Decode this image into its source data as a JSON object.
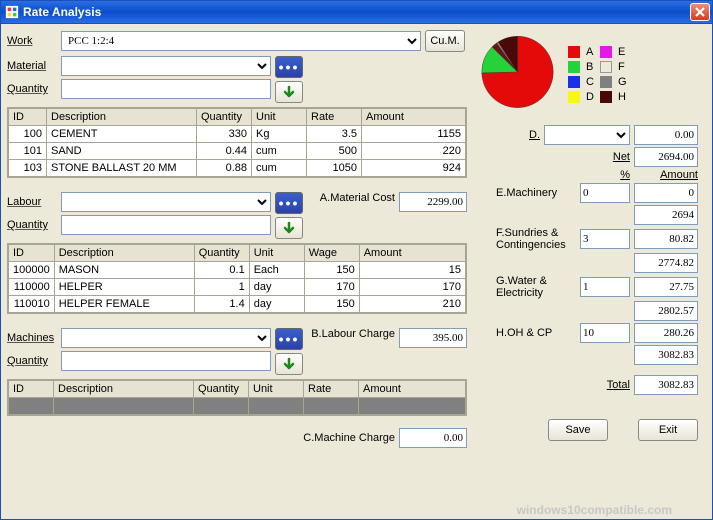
{
  "window": {
    "title": "Rate Analysis"
  },
  "work": {
    "label": "Work",
    "value": "PCC 1:2:4",
    "unit_label": "Cu.M."
  },
  "material": {
    "label": "Material",
    "qty_label": "Quantity",
    "cost_label": "A.Material Cost",
    "cost": "2299.00",
    "headers": [
      "ID",
      "Description",
      "Quantity",
      "Unit",
      "Rate",
      "Amount"
    ],
    "rows": [
      {
        "id": "100",
        "desc": "CEMENT",
        "qty": "330",
        "unit": "Kg",
        "rate": "3.5",
        "amount": "1155"
      },
      {
        "id": "101",
        "desc": "SAND",
        "qty": "0.44",
        "unit": "cum",
        "rate": "500",
        "amount": "220"
      },
      {
        "id": "103",
        "desc": "STONE BALLAST 20 MM",
        "qty": "0.88",
        "unit": "cum",
        "rate": "1050",
        "amount": "924"
      }
    ]
  },
  "labour": {
    "label": "Labour",
    "qty_label": "Quantity",
    "charge_label": "B.Labour Charge",
    "charge": "395.00",
    "headers": [
      "ID",
      "Description",
      "Quantity",
      "Unit",
      "Wage",
      "Amount"
    ],
    "rows": [
      {
        "id": "100000",
        "desc": "MASON",
        "qty": "0.1",
        "unit": "Each",
        "wage": "150",
        "amount": "15"
      },
      {
        "id": "110000",
        "desc": "HELPER",
        "qty": "1",
        "unit": "day",
        "wage": "170",
        "amount": "170"
      },
      {
        "id": "110010",
        "desc": "HELPER FEMALE",
        "qty": "1.4",
        "unit": "day",
        "wage": "150",
        "amount": "210"
      }
    ]
  },
  "machines": {
    "label": "Machines",
    "qty_label": "Quantity",
    "charge_label": "C.Machine Charge",
    "charge": "0.00",
    "headers": [
      "ID",
      "Description",
      "Quantity",
      "Unit",
      "Rate",
      "Amount"
    ]
  },
  "legend": {
    "A": "A",
    "B": "B",
    "C": "C",
    "D": "D",
    "E": "E",
    "F": "F",
    "G": "G",
    "H": "H"
  },
  "summary": {
    "D_label": "D.",
    "D_val": "0.00",
    "net_label": "Net",
    "net": "2694.00",
    "pct_label": "%",
    "amount_label": "Amount",
    "E_label": "E.Machinery",
    "E_in": "0",
    "E_val": "0",
    "sub1": "2694",
    "F_label": "F.Sundries & Contingencies",
    "F_in": "3",
    "F_val": "80.82",
    "sub2": "2774.82",
    "G_label": "G.Water & Electricity",
    "G_in": "1",
    "G_val": "27.75",
    "sub3": "2802.57",
    "H_label": "H.OH & CP",
    "H_in": "10",
    "H_val": "280.26",
    "sub4": "3082.83",
    "total_label": "Total",
    "total": "3082.83"
  },
  "buttons": {
    "save": "Save",
    "exit": "Exit"
  },
  "chart_data": {
    "type": "pie",
    "title": "",
    "series": [
      {
        "name": "breakdown",
        "values": [
          {
            "label": "A",
            "value": 2299.0,
            "color": "#e40a0a"
          },
          {
            "label": "B",
            "value": 395.0,
            "color": "#25d23a"
          },
          {
            "label": "C",
            "value": 0.0,
            "color": "#1b2fe6"
          },
          {
            "label": "D",
            "value": 0.0,
            "color": "#f6f80e"
          },
          {
            "label": "E",
            "value": 0.0,
            "color": "#e718e7"
          },
          {
            "label": "F",
            "value": 80.82,
            "color": "#6c1414"
          },
          {
            "label": "G",
            "value": 27.75,
            "color": "#808080"
          },
          {
            "label": "H",
            "value": 280.26,
            "color": "#4a0808"
          }
        ]
      }
    ],
    "legend_position": "right"
  }
}
